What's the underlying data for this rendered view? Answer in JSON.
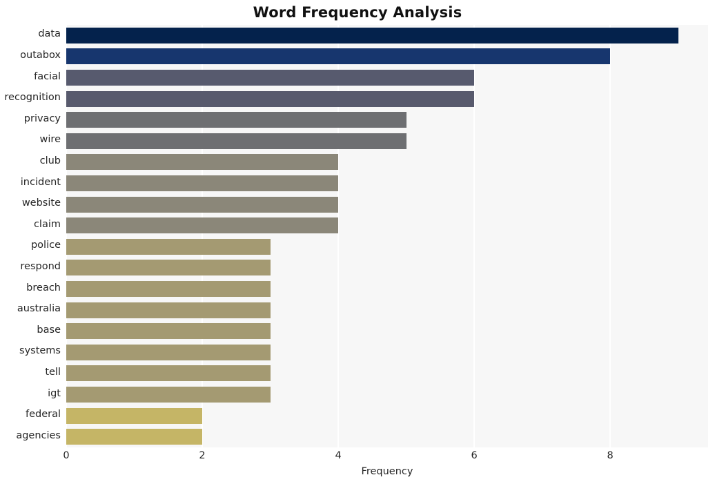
{
  "chart_data": {
    "type": "bar",
    "orientation": "horizontal",
    "title": "Word Frequency Analysis",
    "xlabel": "Frequency",
    "ylabel": "",
    "xlim": [
      0,
      9.44
    ],
    "xticks": [
      0,
      2,
      4,
      6,
      8
    ],
    "xticklabels": [
      "0",
      "2",
      "4",
      "6",
      "8"
    ],
    "grid": "vertical-white",
    "legend": "none",
    "categories": [
      "data",
      "outabox",
      "facial",
      "recognition",
      "privacy",
      "wire",
      "club",
      "incident",
      "website",
      "claim",
      "police",
      "respond",
      "breach",
      "australia",
      "base",
      "systems",
      "tell",
      "igt",
      "federal",
      "agencies"
    ],
    "values": [
      9,
      8,
      6,
      6,
      5,
      5,
      4,
      4,
      4,
      4,
      3,
      3,
      3,
      3,
      3,
      3,
      3,
      3,
      2,
      2
    ],
    "bar_colors": [
      "#04224c",
      "#17366e",
      "#575a6e",
      "#585a6d",
      "#6e6f72",
      "#6e6f72",
      "#8b8779",
      "#8b8779",
      "#8b8779",
      "#8b8779",
      "#a49a72",
      "#a49a72",
      "#a49a72",
      "#a49a72",
      "#a49a72",
      "#a49a72",
      "#a49a72",
      "#a49a72",
      "#c5b566",
      "#c5b566"
    ]
  },
  "style": {
    "plot_background": "#f7f7f7",
    "figure_background": "#ffffff",
    "grid_color": "#ffffff",
    "text_color": "#262626",
    "title_color": "#111111"
  }
}
